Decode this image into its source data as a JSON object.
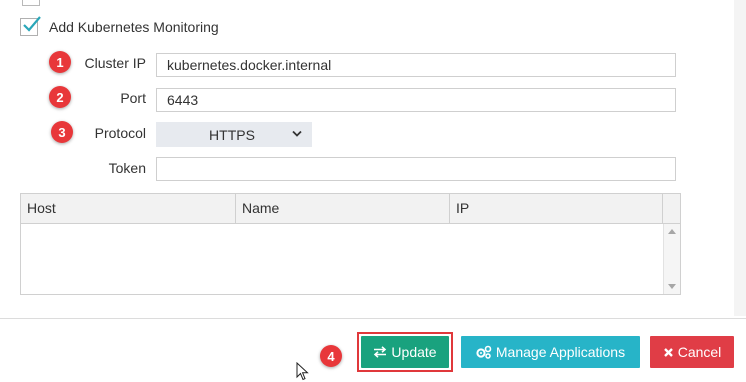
{
  "monitoring": {
    "checkbox_label": "Add Kubernetes Monitoring",
    "checked": true
  },
  "fields": {
    "cluster_ip": {
      "badge": "1",
      "label": "Cluster IP",
      "value": "kubernetes.docker.internal"
    },
    "port": {
      "badge": "2",
      "label": "Port",
      "value": "6443"
    },
    "protocol": {
      "badge": "3",
      "label": "Protocol",
      "value": "HTTPS"
    },
    "token": {
      "label": "Token",
      "value": ""
    }
  },
  "grid": {
    "columns": [
      "Host",
      "Name",
      "IP"
    ],
    "rows": []
  },
  "footer": {
    "update_badge": "4",
    "update_label": "Update",
    "manage_label": "Manage Applications",
    "cancel_label": "Cancel"
  },
  "colors": {
    "badge": "#e8373a",
    "update": "#19a27e",
    "manage": "#27b4c8",
    "cancel": "#e03d46",
    "check": "#2aa7b9"
  },
  "icons": {
    "update": "swap-arrows-icon",
    "manage": "cogs-icon",
    "cancel": "close-icon"
  }
}
